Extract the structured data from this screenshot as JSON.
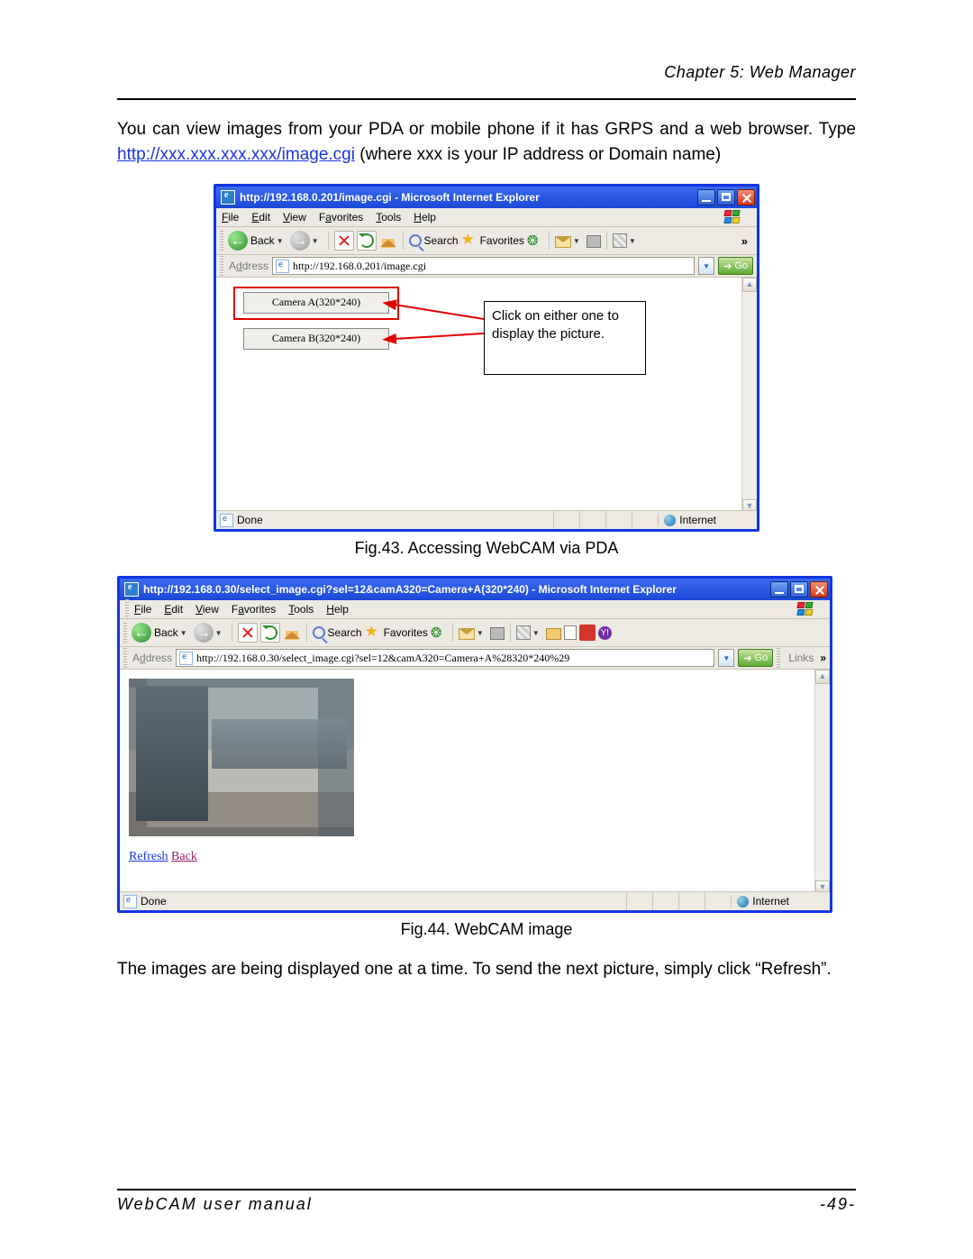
{
  "header": {
    "chapter": "Chapter 5: Web Manager"
  },
  "intro": {
    "before": "You can view images from your PDA or mobile phone if it has GRPS and a web browser.    Type ",
    "link": "http://xxx.xxx.xxx.xxx/image.cgi",
    "after": " (where xxx is your IP address or Domain name)"
  },
  "ie": {
    "menu": {
      "file": "File",
      "edit": "Edit",
      "view": "View",
      "favorites": "Favorites",
      "tools": "Tools",
      "help": "Help"
    },
    "tb": {
      "back": "Back",
      "search": "Search",
      "favorites": "Favorites"
    },
    "addr_label": "Address",
    "go": "Go",
    "links": "Links",
    "status_done": "Done",
    "status_zone": "Internet"
  },
  "fig1": {
    "title": "http://192.168.0.201/image.cgi - Microsoft Internet Explorer",
    "url": "http://192.168.0.201/image.cgi",
    "camA": "Camera A(320*240)",
    "camB": "Camera B(320*240)",
    "annotation": "Click on either one to display the picture.",
    "caption": "Fig.43.  Accessing WebCAM via PDA"
  },
  "fig2": {
    "title": "http://192.168.0.30/select_image.cgi?sel=12&camA320=Camera+A(320*240) - Microsoft Internet Explorer",
    "url": "http://192.168.0.30/select_image.cgi?sel=12&camA320=Camera+A%28320*240%29",
    "refresh": "Refresh",
    "back": "Back",
    "caption": "Fig.44.  WebCAM image"
  },
  "outro": "The images are being displayed one at a time.   To send the next picture, simply click “Refresh”.",
  "footer": {
    "manual": "WebCAM user manual",
    "page": "-49-"
  }
}
